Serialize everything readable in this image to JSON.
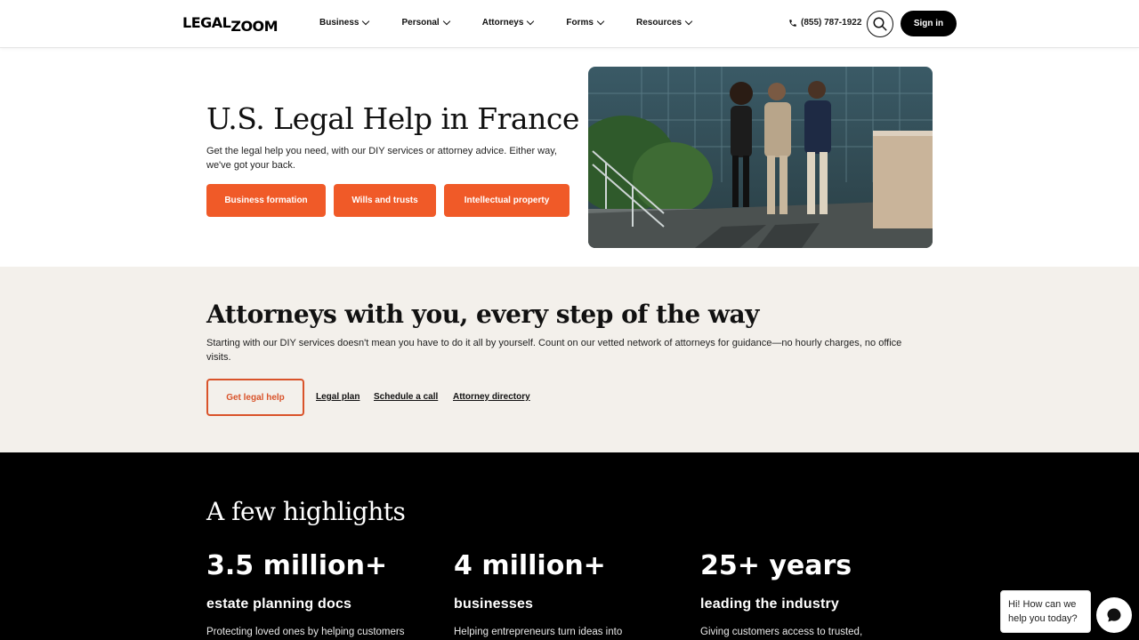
{
  "header": {
    "logo_part1": "LEGAL",
    "logo_part2": "ZOOM",
    "nav": [
      {
        "label": "Business"
      },
      {
        "label": "Personal"
      },
      {
        "label": "Attorneys"
      },
      {
        "label": "Forms"
      },
      {
        "label": "Resources"
      }
    ],
    "phone": "(855) 787-1922",
    "signin_label": "Sign in"
  },
  "hero": {
    "title": "U.S. Legal Help in France",
    "subtitle": "Get the legal help you need, with our DIY services or attorney advice. Either way, we've got your back.",
    "buttons": [
      {
        "label": "Business formation"
      },
      {
        "label": "Wills and trusts"
      },
      {
        "label": "Intellectual property"
      }
    ]
  },
  "attorneys": {
    "title": "Attorneys with you, every step of the way",
    "subtitle": "Starting with our DIY services doesn't mean you have to do it all by yourself. Count on our vetted network of attorneys for guidance—no hourly charges, no office visits.",
    "cta_label": "Get legal help",
    "links": [
      {
        "label": "Legal plan"
      },
      {
        "label": "Schedule a call"
      },
      {
        "label": "Attorney directory"
      }
    ]
  },
  "highlights": {
    "title": "A few highlights",
    "stats": [
      {
        "number": "3.5 million+",
        "label": "estate planning docs",
        "desc": "Protecting loved ones by helping customers"
      },
      {
        "number": "4 million+",
        "label": "businesses",
        "desc": "Helping entrepreneurs turn ideas into"
      },
      {
        "number": "25+ years",
        "label": "leading the industry",
        "desc": "Giving customers access to trusted,"
      }
    ]
  },
  "chat": {
    "message": "Hi! How can we help you today?"
  },
  "colors": {
    "accent": "#f05a28",
    "accent_dark": "#d9532a",
    "section_bg": "#f3f0eb",
    "dark_bg": "#000000"
  }
}
